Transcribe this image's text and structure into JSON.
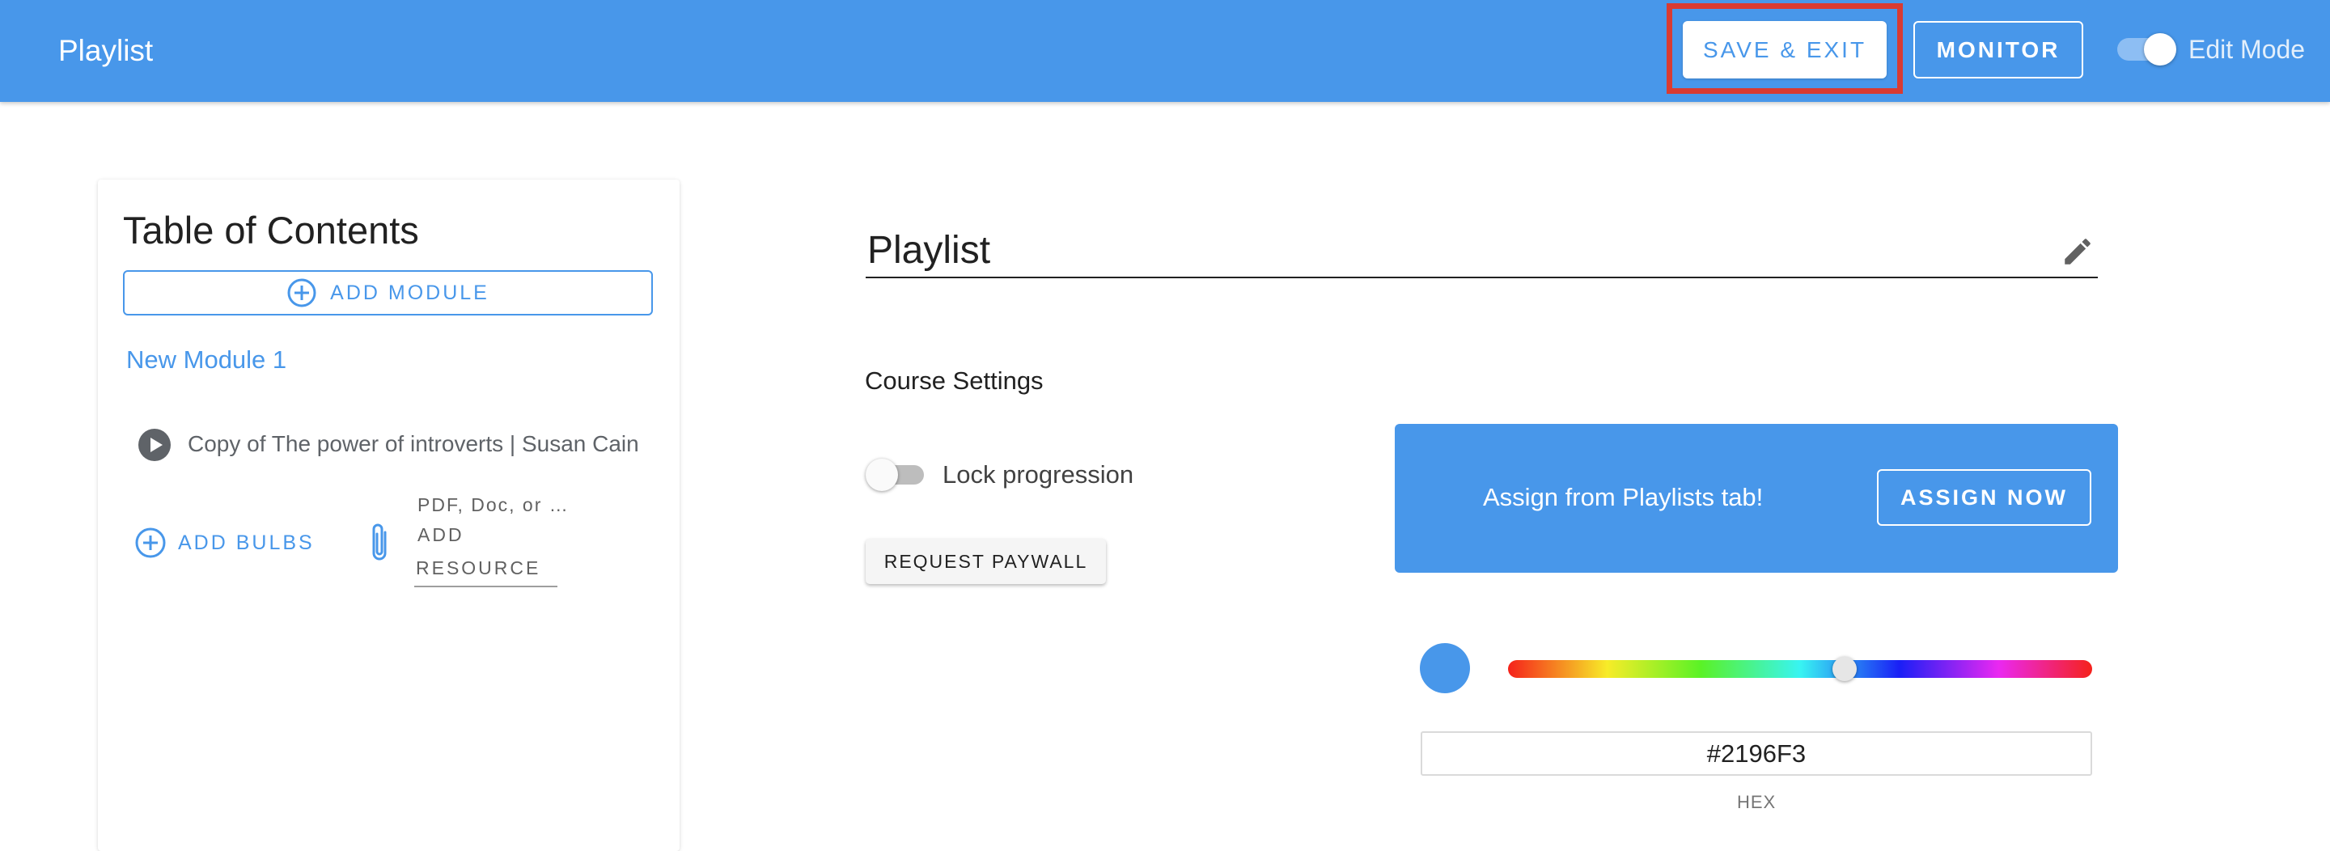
{
  "header": {
    "title": "Playlist",
    "save_exit_label": "SAVE & EXIT",
    "monitor_label": "MONITOR",
    "edit_mode_label": "Edit Mode",
    "edit_mode_on": true
  },
  "toc": {
    "title": "Table of Contents",
    "add_module_label": "ADD MODULE",
    "module_title": "New Module 1",
    "lesson_title": "Copy of The power of introverts | Susan Cain",
    "add_bulbs_label": "ADD BULBS",
    "resource_hint": "PDF, Doc, or …",
    "add_resource_label": "ADD",
    "resource_label": "RESOURCE"
  },
  "main": {
    "playlist_name": "Playlist",
    "course_settings_label": "Course Settings",
    "lock_progression_label": "Lock progression",
    "lock_progression_on": false,
    "request_paywall_label": "REQUEST PAYWALL",
    "assign_text": "Assign from Playlists tab!",
    "assign_button_label": "ASSIGN NOW"
  },
  "color_picker": {
    "hex_value": "#2196F3",
    "hex_label": "HEX",
    "swatch_color": "#4897ea"
  },
  "colors": {
    "accent": "#4897ea",
    "highlight": "#d93b32"
  },
  "icons": {
    "add_module": "plus-circle-icon",
    "lesson": "play-circle-icon",
    "add_bulbs": "plus-circle-icon",
    "resource": "paperclip-icon",
    "edit_name": "pencil-icon"
  }
}
